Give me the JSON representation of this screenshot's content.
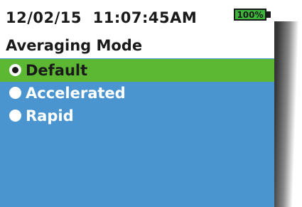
{
  "status": {
    "date": "12/02/15",
    "time": "11:07:45AM",
    "battery_level": "100%"
  },
  "screen": {
    "title": "Averaging Mode"
  },
  "options": [
    {
      "label": "Default",
      "selected": true
    },
    {
      "label": "Accelerated",
      "selected": false
    },
    {
      "label": "Rapid",
      "selected": false
    }
  ],
  "colors": {
    "background": "#4a95d0",
    "selected": "#5cb832",
    "battery": "#3cb53a"
  }
}
